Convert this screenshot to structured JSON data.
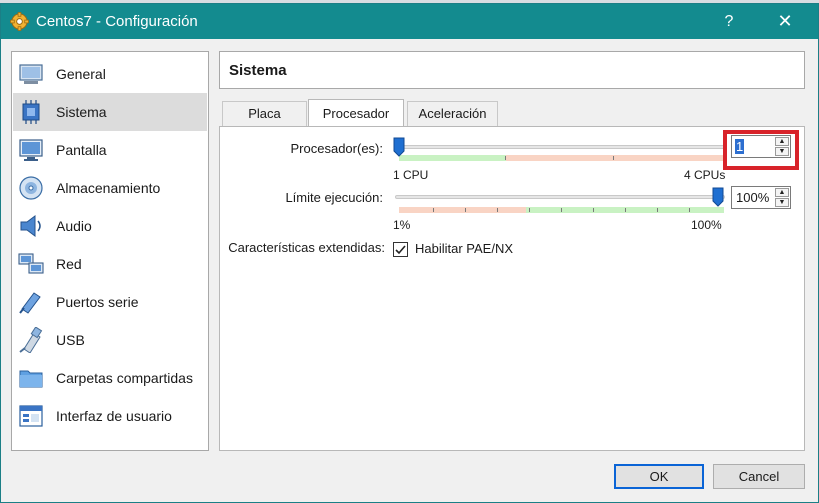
{
  "window": {
    "title": "Centos7 - Configuración",
    "help_glyph": "?",
    "close_glyph": "✕"
  },
  "sidebar": {
    "items": [
      {
        "label": "General",
        "icon": "general-icon",
        "selected": false
      },
      {
        "label": "Sistema",
        "icon": "chip-icon",
        "selected": true
      },
      {
        "label": "Pantalla",
        "icon": "monitor-icon",
        "selected": false
      },
      {
        "label": "Almacenamiento",
        "icon": "disk-icon",
        "selected": false
      },
      {
        "label": "Audio",
        "icon": "speaker-icon",
        "selected": false
      },
      {
        "label": "Red",
        "icon": "network-icon",
        "selected": false
      },
      {
        "label": "Puertos serie",
        "icon": "serial-port-icon",
        "selected": false
      },
      {
        "label": "USB",
        "icon": "usb-icon",
        "selected": false
      },
      {
        "label": "Carpetas compartidas",
        "icon": "folder-icon",
        "selected": false
      },
      {
        "label": "Interfaz de usuario",
        "icon": "ui-window-icon",
        "selected": false
      }
    ]
  },
  "header": {
    "title": "Sistema"
  },
  "tabs": [
    {
      "label": "Placa base",
      "active": false
    },
    {
      "label": "Procesador",
      "active": true
    },
    {
      "label": "Aceleración",
      "active": false
    }
  ],
  "processor": {
    "label": "Procesador(es):",
    "value": "1",
    "min_label": "1 CPU",
    "max_label": "4 CPUs",
    "min": 1,
    "max": 4
  },
  "exec_limit": {
    "label": "Límite ejecución:",
    "value": "100%",
    "min_label": "1%",
    "max_label": "100%",
    "min": 1,
    "max": 100
  },
  "extended": {
    "label": "Características extendidas:",
    "checkbox_label": "Habilitar PAE/NX",
    "checked": true
  },
  "buttons": {
    "ok": "OK",
    "cancel": "Cancel"
  },
  "colors": {
    "titlebar": "#138b8f",
    "range_good": "#c9f2c3",
    "range_warn": "#f9d4c4",
    "highlight": "#d8232a",
    "thumb": "#1f6fd1"
  }
}
